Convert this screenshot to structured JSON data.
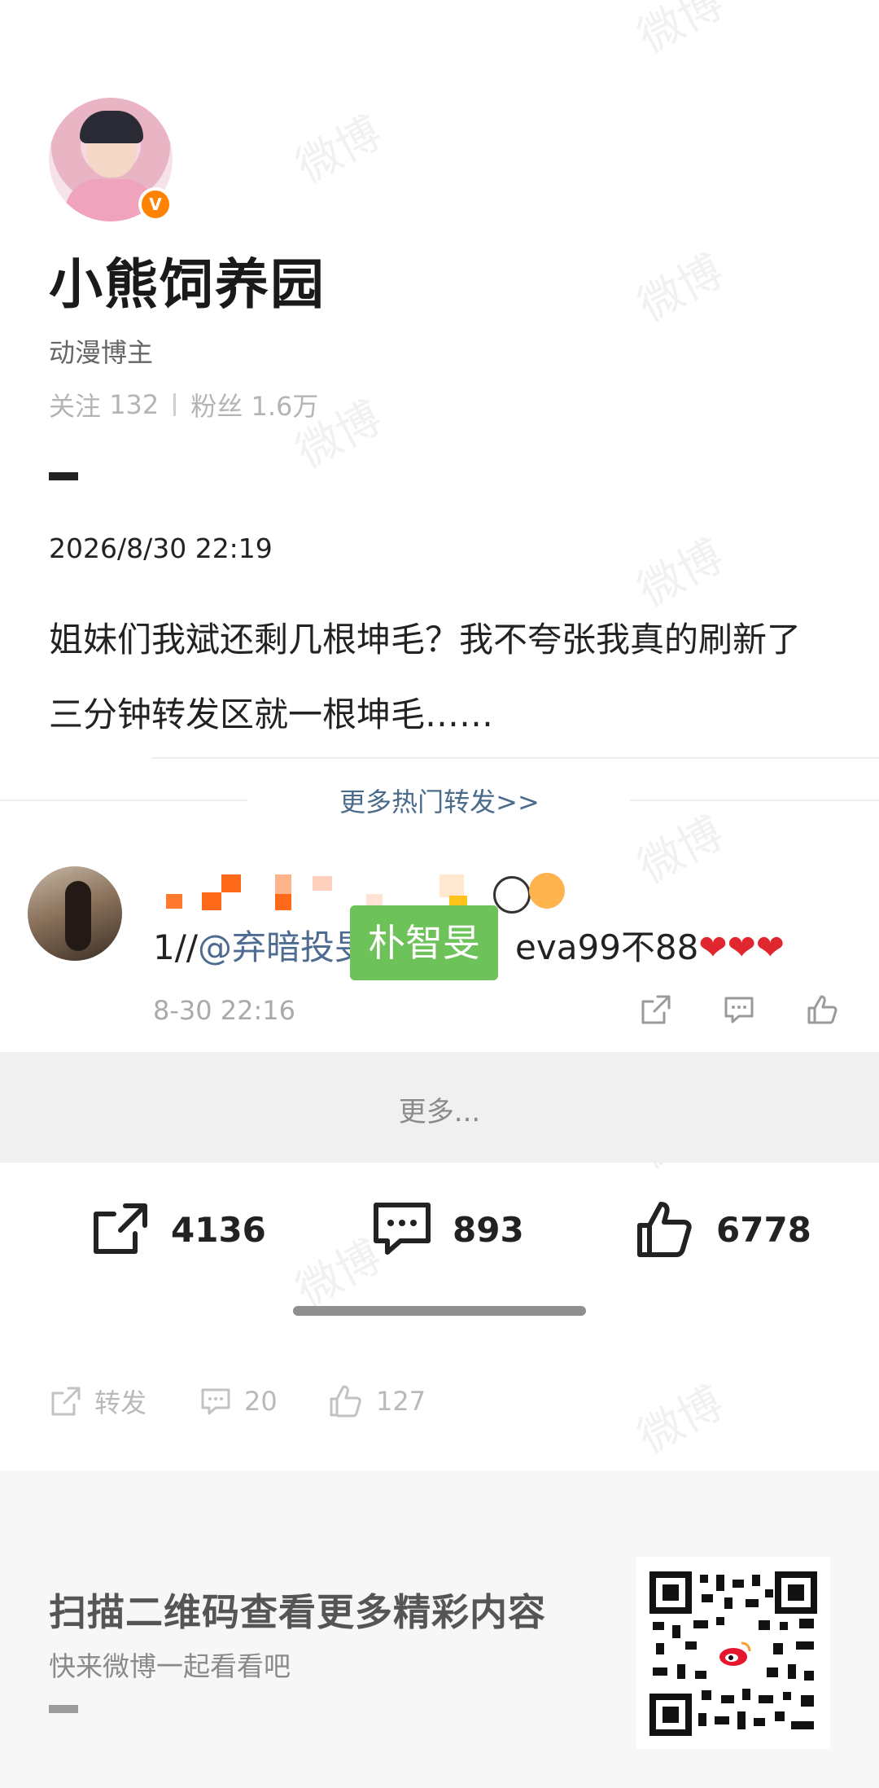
{
  "watermark": "微博",
  "profile": {
    "name": "小熊饲养园",
    "role": "动漫博主",
    "following_label": "关注",
    "following_count": "132",
    "followers_label": "粉丝",
    "followers_count": "1.6万",
    "verified_badge": "V"
  },
  "post": {
    "date": "2026/8/30 22:19",
    "text": "姐妹们我斌还剩几根坤毛？我不夸张我真的刷新了三分钟转发区就一根坤毛……"
  },
  "hot_reposts_link": "更多热门转发>>",
  "repost": {
    "prefix": "1//",
    "mention": "@弃暗投旻",
    "overlay_tag": "朴智旻",
    "suffix": "eva99不88",
    "hearts": "❤❤❤",
    "time": "8-30 22:16"
  },
  "more_label": "更多...",
  "stats": {
    "reposts": "4136",
    "comments": "893",
    "likes": "6778"
  },
  "small_stats": {
    "repost_label": "转发",
    "comments": "20",
    "likes": "127"
  },
  "footer": {
    "title": "扫描二维码查看更多精彩内容",
    "subtitle": "快来微博一起看看吧"
  },
  "colors": {
    "accent_orange": "#ff8200",
    "mention_blue": "#4e6b91",
    "tag_green": "#6ec25a"
  }
}
